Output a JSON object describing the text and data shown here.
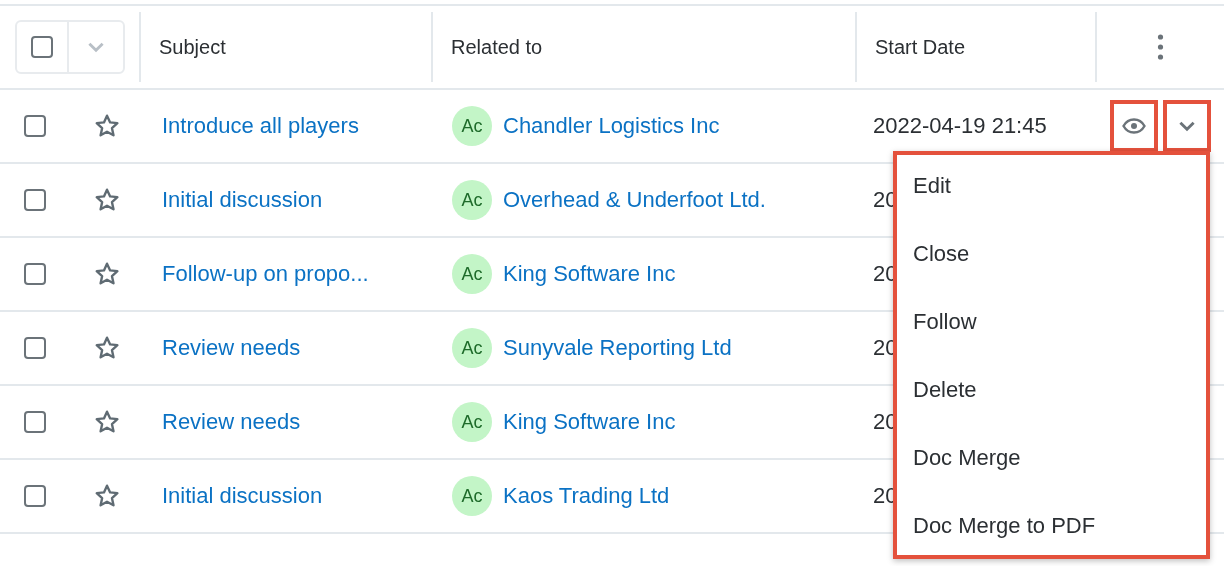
{
  "header": {
    "select_all_checked": false,
    "columns": [
      "Subject",
      "Related to",
      "Start Date"
    ]
  },
  "rows": [
    {
      "checked": false,
      "favorite": false,
      "subject": "Introduce all players",
      "avatar": "Ac",
      "related": "Chandler Logistics Inc",
      "start_date": "2022-04-19 21:45",
      "actions": true
    },
    {
      "checked": false,
      "favorite": false,
      "subject": "Initial discussion",
      "avatar": "Ac",
      "related": "Overhead & Underfoot Ltd.",
      "start_date": "20",
      "actions": false
    },
    {
      "checked": false,
      "favorite": false,
      "subject": "Follow-up on propo...",
      "avatar": "Ac",
      "related": "King Software Inc",
      "start_date": "20",
      "actions": false
    },
    {
      "checked": false,
      "favorite": false,
      "subject": "Review needs",
      "avatar": "Ac",
      "related": "Sunyvale Reporting Ltd",
      "start_date": "20",
      "actions": false
    },
    {
      "checked": false,
      "favorite": false,
      "subject": "Review needs",
      "avatar": "Ac",
      "related": "King Software Inc",
      "start_date": "20",
      "actions": false
    },
    {
      "checked": false,
      "favorite": false,
      "subject": "Initial discussion",
      "avatar": "Ac",
      "related": "Kaos Trading Ltd",
      "start_date": "20",
      "actions": false
    }
  ],
  "row_actions": {
    "preview_highlighted": true,
    "dropdown_highlighted": true
  },
  "menu": {
    "highlighted": true,
    "items": [
      "Edit",
      "Close",
      "Follow",
      "Delete",
      "Doc Merge",
      "Doc Merge to PDF"
    ]
  }
}
